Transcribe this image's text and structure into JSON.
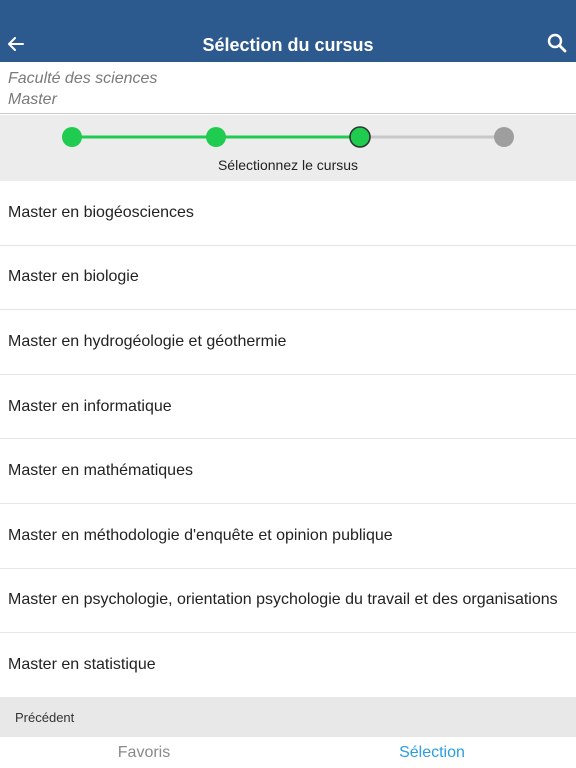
{
  "header": {
    "title": "Sélection du cursus",
    "back_icon": "arrow-left-icon",
    "search_icon": "search-icon",
    "background_color": "#2d5a8e"
  },
  "breadcrumb": {
    "faculty": "Faculté des sciences",
    "level": "Master"
  },
  "stepper": {
    "label": "Sélectionnez le cursus",
    "total_steps": 4,
    "current_step": 3,
    "done_color": "#1fcc4f",
    "pending_color": "#9e9e9e"
  },
  "programs": [
    "Master en biogéosciences",
    "Master en biologie",
    "Master en hydrogéologie et géothermie",
    "Master en informatique",
    "Master en mathématiques",
    "Master en méthodologie d'enquête et opinion publique",
    "Master en psychologie, orientation psychologie du travail et des organisations",
    "Master en statistique"
  ],
  "footer": {
    "previous_label": "Précédent"
  },
  "tabs": {
    "favoris": "Favoris",
    "selection": "Sélection",
    "active_color": "#2a9ee0",
    "inactive_color": "#8a8a8a"
  }
}
